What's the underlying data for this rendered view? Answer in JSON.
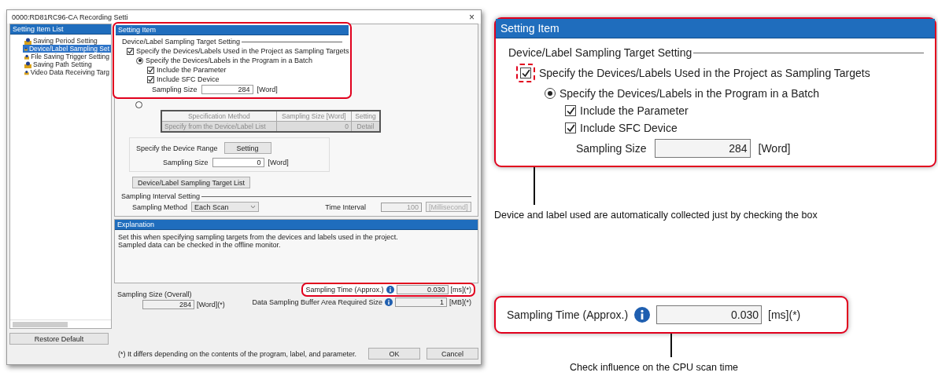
{
  "window": {
    "title": "0000:RD81RC96-CA Recording Setti",
    "close": "×"
  },
  "sidebar": {
    "title": "Setting Item List",
    "items": [
      {
        "label": "Saving Period Setting",
        "selected": false
      },
      {
        "label": "Device/Label Sampling Set",
        "selected": true
      },
      {
        "label": "File Saving Trigger Setting",
        "selected": false
      },
      {
        "label": "Saving Path Setting",
        "selected": false
      },
      {
        "label": "Video Data Receiving Targ",
        "selected": false
      }
    ],
    "restore_button": "Restore Default"
  },
  "setting_panel": {
    "title": "Setting Item",
    "highlighted": true,
    "target_group": {
      "title": "Device/Label Sampling Target Setting",
      "use_project": {
        "label": "Specify the Devices/Labels Used in the Project as Sampling Targets",
        "checked": true
      },
      "batch": {
        "label": "Specify the Devices/Labels in the Program in a Batch",
        "selected": true
      },
      "include_parameter": {
        "label": "Include the Parameter",
        "checked": true
      },
      "include_sfc": {
        "label": "Include SFC Device",
        "checked": true
      },
      "sampling_size": {
        "label": "Sampling Size",
        "value": "284",
        "unit": "[Word]"
      },
      "specify_target": {
        "selected": false
      },
      "table": {
        "disabled": true,
        "columns": [
          "Specification Method",
          "Sampling Size [Word]",
          "Setting"
        ],
        "rows": [
          [
            "Specify from the Device/Label List",
            "0",
            "Detail"
          ]
        ]
      },
      "device_range": {
        "label": "Specify the Device Range",
        "button": "Setting",
        "size_label": "Sampling Size",
        "size_value": "0",
        "unit": "[Word]"
      },
      "list_button": "Device/Label Sampling Target List"
    },
    "interval_group": {
      "title": "Sampling Interval Setting",
      "method_label": "Sampling Method",
      "method_value": "Each Scan",
      "time_label": "Time Interval",
      "time_value": "100",
      "time_unit": "[Millisecond]",
      "time_disabled": true
    }
  },
  "explanation": {
    "title": "Explanation",
    "lines": [
      "Set this when specifying sampling targets from the devices and labels used in the project.",
      "Sampled data can be checked in the offline monitor."
    ]
  },
  "summary": {
    "size_label": "Sampling Size (Overall)",
    "size_value": "284",
    "size_unit": "[Word](*)",
    "time": {
      "label": "Sampling Time (Approx.)",
      "value": "0.030",
      "unit": "[ms](*)",
      "highlighted": true
    },
    "buffer": {
      "label": "Data Sampling Buffer Area Required Size",
      "value": "1",
      "unit": "[MB](*)"
    }
  },
  "footer": {
    "note": "(*) It differs depending on the contents of the program, label, and parameter.",
    "buttons": [
      "OK",
      "Cancel"
    ]
  },
  "callouts": [
    {
      "kind": "setting",
      "title": "Setting Item",
      "group_title": "Device/Label Sampling Target Setting",
      "use_project": {
        "label": "Specify the Devices/Labels Used in the Project as Sampling Targets",
        "checked": true
      },
      "batch": {
        "label": "Specify the Devices/Labels in the Program in a Batch",
        "selected": true
      },
      "checks": [
        {
          "label": "Include the Parameter",
          "checked": true
        },
        {
          "label": "Include SFC Device",
          "checked": true
        }
      ],
      "size_label": "Sampling Size",
      "size_value": "284",
      "size_unit": "[Word]",
      "caption": "Device and label used are automatically collected just by checking the box"
    },
    {
      "kind": "time",
      "label": "Sampling Time (Approx.)",
      "value": "0.030",
      "unit": "[ms](*)",
      "caption": "Check influence on the CPU scan time"
    }
  ]
}
